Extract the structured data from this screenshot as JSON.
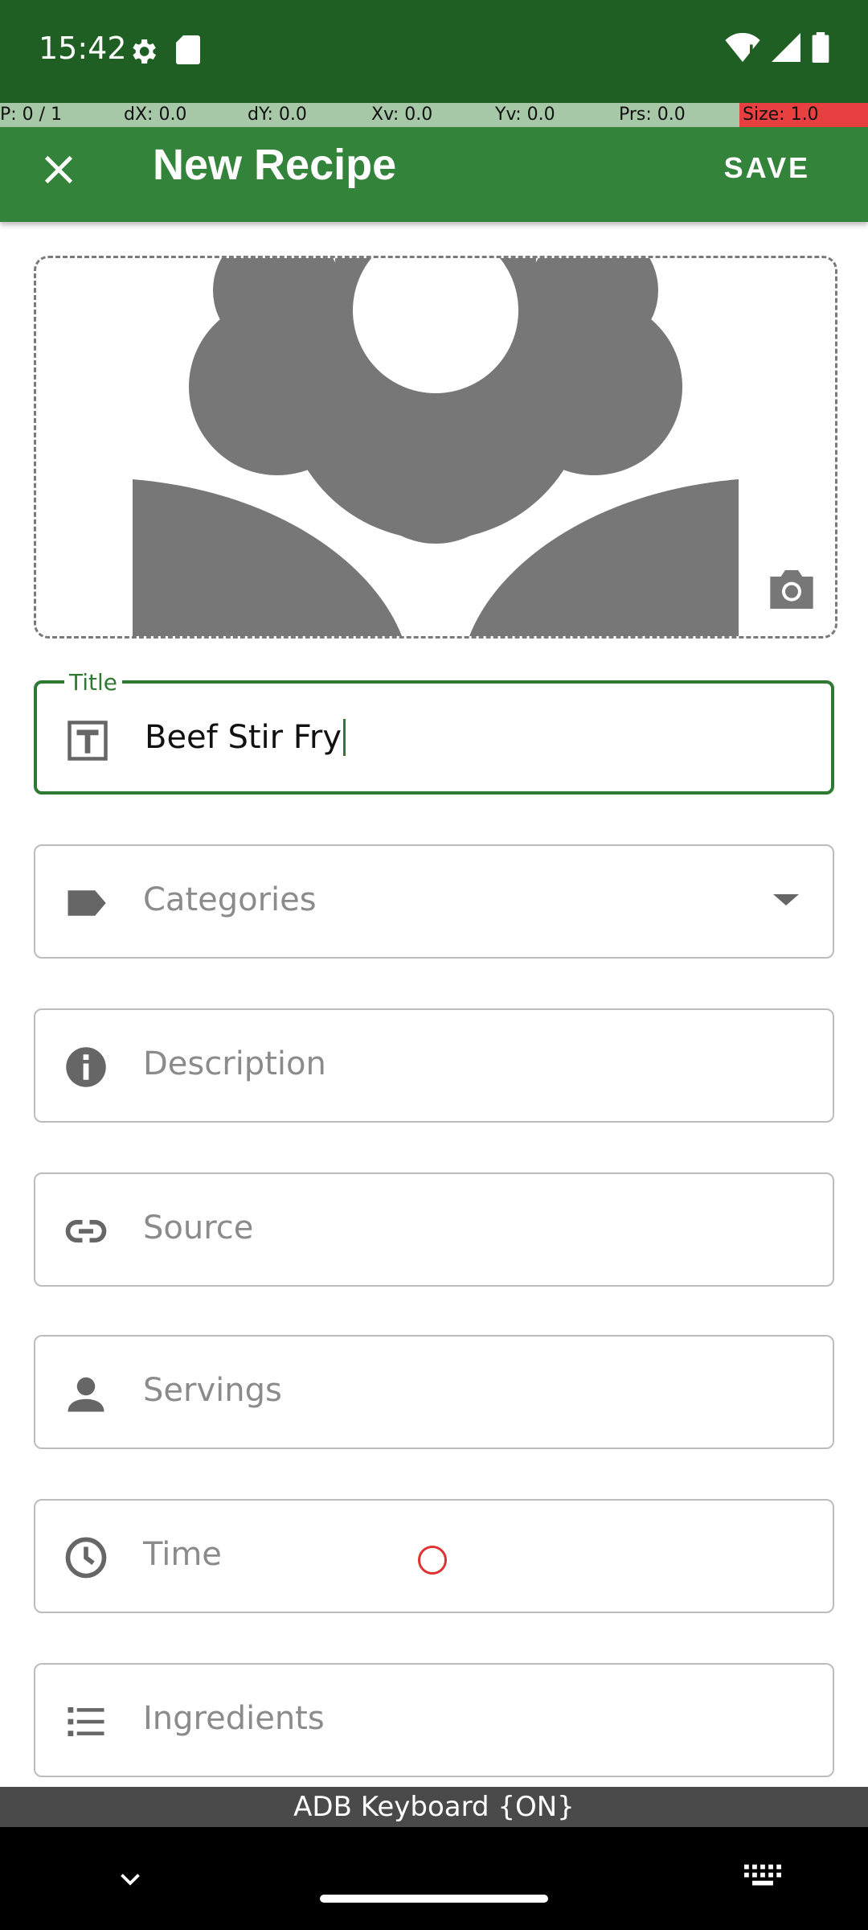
{
  "status_bar": {
    "time": "15:42",
    "icons": [
      "gear-icon",
      "sd-card-icon",
      "wifi-icon",
      "signal-icon",
      "battery-icon"
    ]
  },
  "debug_bar": {
    "p": "P: 0 / 1",
    "dx": "dX: 0.0",
    "dy": "dY: 0.0",
    "xv": "Xv: 0.0",
    "yv": "Yv: 0.0",
    "prs": "Prs: 0.0",
    "size": "Size: 1.0"
  },
  "app_bar": {
    "title": "New Recipe",
    "save_label": "SAVE",
    "close_icon": "close-icon"
  },
  "image_placeholder": {
    "icon": "flower-icon",
    "camera_icon": "camera-icon"
  },
  "form": {
    "title": {
      "legend": "Title",
      "value": "Beef Stir Fry"
    },
    "categories": {
      "label": "Categories"
    },
    "description": {
      "label": "Description"
    },
    "source": {
      "label": "Source"
    },
    "servings": {
      "label": "Servings"
    },
    "time": {
      "label": "Time"
    },
    "ingredients": {
      "label": "Ingredients"
    }
  },
  "keyboard_banner": "ADB Keyboard {ON}",
  "colors": {
    "status_bar": "#1f5f24",
    "app_bar": "#34833a",
    "accent": "#2f7a33"
  }
}
